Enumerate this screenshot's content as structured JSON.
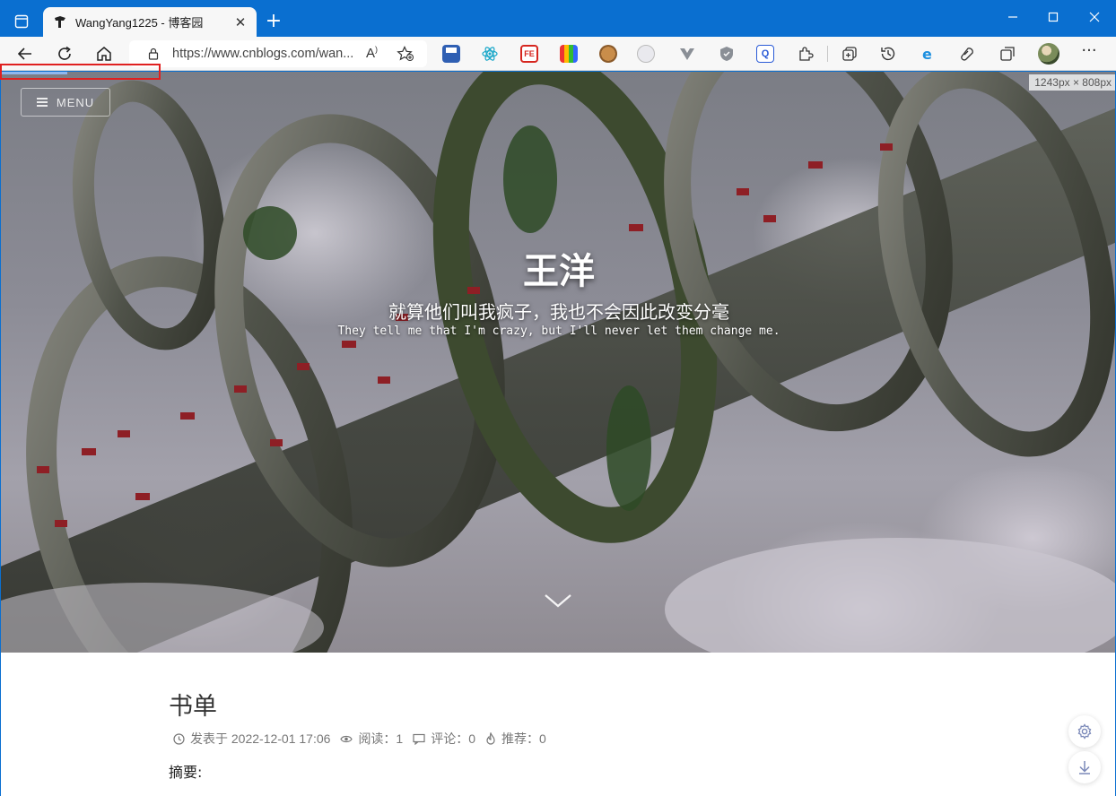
{
  "browser": {
    "tab_title": "WangYang1225 - 博客园",
    "url": "https://www.cnblogs.com/wan...",
    "window_controls": {
      "minimize": "—",
      "maximize": "☐",
      "close": "✕"
    }
  },
  "page": {
    "size_label": "1243px × 808px",
    "menu_label": "MENU",
    "hero": {
      "title": "王洋",
      "subtitle_cn": "就算他们叫我疯子，我也不会因此改变分毫",
      "subtitle_en": "They tell me that I'm crazy, but I'll never let them change me."
    },
    "post": {
      "title": "书单",
      "published": "发表于 2022-12-01 17:06",
      "reads": "阅读：1",
      "comments": "评论：0",
      "recommends": "推荐：0",
      "summary_label": "摘要:"
    }
  },
  "colors": {
    "browser_frame": "#0a6fd0",
    "toolbar": "#f7f7f7",
    "progress": "#8fb7ef",
    "highlight_box": "#e02020"
  }
}
